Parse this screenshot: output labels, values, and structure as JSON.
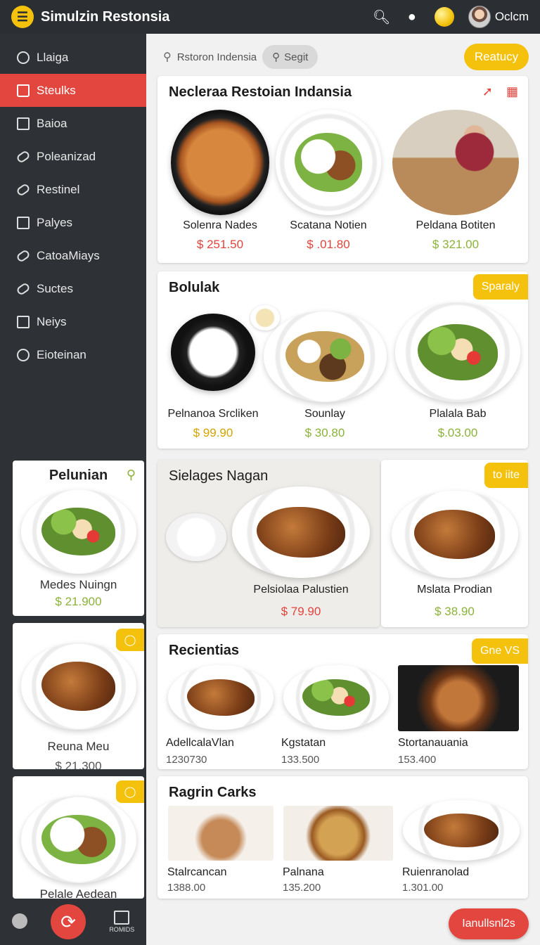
{
  "app": {
    "title": "Simulzin Restonsia",
    "menu_icon": "menu-icon",
    "user_name": "Oclcm"
  },
  "colors": {
    "accent_red": "#e2463f",
    "accent_yellow": "#f4c20d",
    "sidebar": "#2e3135",
    "price_green": "#8bb33a"
  },
  "sidebar": {
    "items": [
      {
        "label": "Llaiga",
        "icon": "clock-icon"
      },
      {
        "label": "Steulks",
        "icon": "bag-icon",
        "active": true
      },
      {
        "label": "Baioa",
        "icon": "square-icon"
      },
      {
        "label": "Poleanizad",
        "icon": "tag-icon"
      },
      {
        "label": "Restinel",
        "icon": "tag-icon"
      },
      {
        "label": "Palyes",
        "icon": "export-icon"
      },
      {
        "label": "CatoaMiays",
        "icon": "tag-icon"
      },
      {
        "label": "Suctes",
        "icon": "tag-icon"
      },
      {
        "label": "Neiys",
        "icon": "square-icon"
      },
      {
        "label": "Eioteinan",
        "icon": "gauge-icon"
      }
    ],
    "cards": [
      {
        "title": "Pelunian",
        "name": "Medes Nuingn",
        "price": "$ 21.900"
      },
      {
        "name": "Reuna Meu",
        "price": "$ 21.300"
      },
      {
        "name": "Pelale Aedean"
      }
    ],
    "bottom": {
      "label": "ROMIDS"
    }
  },
  "search": {
    "placeholder": "Rstoron Indensia",
    "button": "Segit"
  },
  "reserve_button": "Reatucy",
  "sections": {
    "s1": {
      "title": "Necleraa Restoian Indansia",
      "items": [
        {
          "name": "Solenra Nades",
          "price": "$ 251.50"
        },
        {
          "name": "Scatana Notien",
          "price": "$ .01.80"
        },
        {
          "name": "Peldana Botiten",
          "price": "$ 321.00"
        }
      ]
    },
    "s2": {
      "title": "Bolulak",
      "badge": "Sparaly",
      "items": [
        {
          "name": "Pelnanoa Srcliken",
          "price": "$ 99.90"
        },
        {
          "name": "Sounlay",
          "price": "$ 30.80"
        },
        {
          "name": "Plalala Bab",
          "price": "$.03.00"
        }
      ]
    },
    "s3": {
      "title": "Sielages Nagan",
      "item": {
        "name": "Pelsiolaa Palustien",
        "price": "$ 79.90"
      }
    },
    "s3b": {
      "badge": "to iite",
      "item": {
        "name": "Mslata Prodian",
        "price": "$ 38.90"
      }
    },
    "s4": {
      "title": "Recientias",
      "badge": "Gne VS",
      "items": [
        {
          "name": "AdellcalaVlan",
          "price": "1230730"
        },
        {
          "name": "Kgstatan",
          "price": "133.500"
        },
        {
          "name": "Stortanauania",
          "price": "153.400"
        }
      ]
    },
    "s5": {
      "title": "Ragrin Carks",
      "items": [
        {
          "name": "Stalrcancan",
          "price": "1388.00"
        },
        {
          "name": "Palnana",
          "price": "135.200"
        },
        {
          "name": "Ruienranolad",
          "price": "1.301.00"
        }
      ]
    }
  },
  "bottom_action": "Ianullsnl2s"
}
